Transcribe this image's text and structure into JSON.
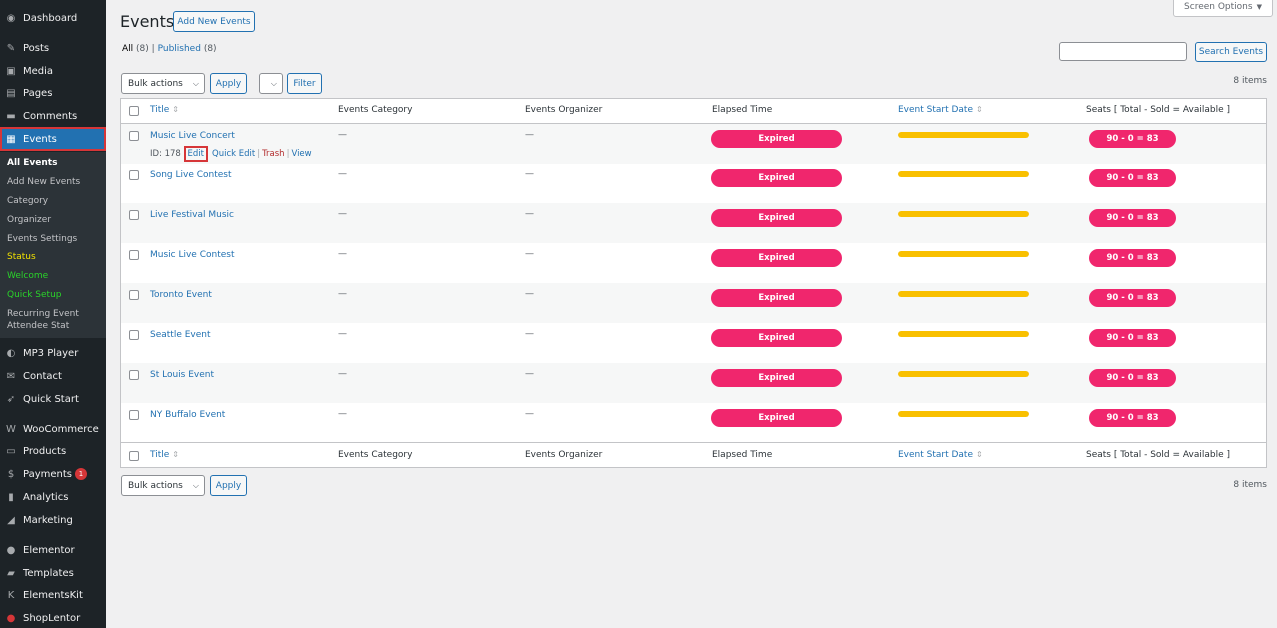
{
  "sidebar": {
    "items": [
      {
        "label": "Dashboard",
        "icon": "dashboard-icon"
      },
      {
        "label": "Posts",
        "icon": "pin-icon"
      },
      {
        "label": "Media",
        "icon": "media-icon"
      },
      {
        "label": "Pages",
        "icon": "pages-icon"
      },
      {
        "label": "Comments",
        "icon": "comment-icon"
      },
      {
        "label": "Events",
        "icon": "calendar-icon"
      },
      {
        "label": "MP3 Player",
        "icon": "player-icon"
      },
      {
        "label": "Contact",
        "icon": "mail-icon"
      },
      {
        "label": "Quick Start",
        "icon": "rocket-icon"
      },
      {
        "label": "WooCommerce",
        "icon": "woo-icon"
      },
      {
        "label": "Products",
        "icon": "box-icon"
      },
      {
        "label": "Payments",
        "icon": "dollar-icon",
        "badge": "1"
      },
      {
        "label": "Analytics",
        "icon": "bar-chart-icon"
      },
      {
        "label": "Marketing",
        "icon": "megaphone-icon"
      },
      {
        "label": "Elementor",
        "icon": "elementor-icon"
      },
      {
        "label": "Templates",
        "icon": "folder-icon"
      },
      {
        "label": "ElementsKit",
        "icon": "ek-icon"
      },
      {
        "label": "ShopLentor",
        "icon": "shoplentor-icon"
      }
    ],
    "submenu": [
      "All Events",
      "Add New Events",
      "Category",
      "Organizer",
      "Events Settings",
      "Status",
      "Welcome",
      "Quick Setup",
      "Recurring Event",
      "Attendee Stat"
    ]
  },
  "header": {
    "title": "Events",
    "add_new": "Add New Events",
    "screen_options": "Screen Options"
  },
  "filters": {
    "all_label": "All",
    "all_count": "(8)",
    "sep": "|",
    "published_label": "Published",
    "published_count": "(8)",
    "search_button": "Search Events",
    "bulk_actions": "Bulk actions",
    "apply": "Apply",
    "filter": "Filter",
    "items_count": "8 items"
  },
  "table": {
    "columns": [
      "Title",
      "Events Category",
      "Events Organizer",
      "Elapsed Time",
      "Event Start Date",
      "Seats [ Total - Sold = Available ]"
    ],
    "rows": [
      {
        "title": "Music Live Concert",
        "category": "—",
        "organizer": "—",
        "status": "Expired",
        "progress": 1.0,
        "seats": "90 - 0 = 83"
      },
      {
        "title": "Song Live Contest",
        "category": "—",
        "organizer": "—",
        "status": "Expired",
        "progress": 1.0,
        "seats": "90 - 0 = 83"
      },
      {
        "title": "Live Festival Music",
        "category": "—",
        "organizer": "—",
        "status": "Expired",
        "progress": 1.0,
        "seats": "90 - 0 = 83"
      },
      {
        "title": "Music Live Contest",
        "category": "—",
        "organizer": "—",
        "status": "Expired",
        "progress": 1.0,
        "seats": "90 - 0 = 83"
      },
      {
        "title": "Toronto Event",
        "category": "—",
        "organizer": "—",
        "status": "Expired",
        "progress": 1.0,
        "seats": "90 - 0 = 83"
      },
      {
        "title": "Seattle Event",
        "category": "—",
        "organizer": "—",
        "status": "Expired",
        "progress": 1.0,
        "seats": "90 - 0 = 83"
      },
      {
        "title": "St Louis Event",
        "category": "—",
        "organizer": "—",
        "status": "Expired",
        "progress": 1.0,
        "seats": "90 - 0 = 83"
      },
      {
        "title": "NY Buffalo Event",
        "category": "—",
        "organizer": "—",
        "status": "Expired",
        "progress": 1.0,
        "seats": "90 - 0 = 83"
      }
    ],
    "row_actions": {
      "id": "ID: 178",
      "edit": "Edit",
      "quick_edit": "Quick Edit",
      "trash": "Trash",
      "view": "View"
    }
  },
  "colors": {
    "accent": "#2271b1",
    "expired": "#f0266d",
    "progress": "#f9c000",
    "highlight": "#d63638"
  }
}
